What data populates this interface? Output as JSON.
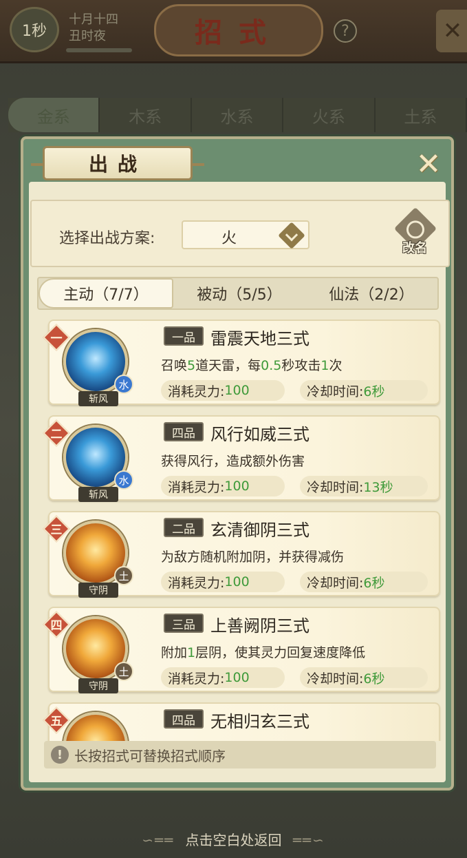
{
  "background": {
    "timer": "1秒",
    "date_line1": "十月十四",
    "date_line2": "丑时夜",
    "title": "招式",
    "help_icon": "question-icon",
    "close_icon": "close-icon",
    "element_tabs": [
      "金系",
      "木系",
      "水系",
      "火系",
      "土系"
    ],
    "active_element_tab": "金系"
  },
  "dialog": {
    "title": "出战",
    "close_icon": "close-icon",
    "scheme": {
      "label": "选择出战方案:",
      "value": "火",
      "rename_label": "改名"
    },
    "tabs": [
      {
        "label": "主动（7/7）",
        "active": true
      },
      {
        "label": "被动（5/5）",
        "active": false
      },
      {
        "label": "仙法（2/2）",
        "active": false
      }
    ],
    "skills": [
      {
        "rank": "一",
        "grade": "一品",
        "name": "雷震天地三式",
        "desc_parts": [
          "召唤",
          "5",
          "道天雷，每",
          "0.5",
          "秒攻击",
          "1",
          "次"
        ],
        "element": "水",
        "element_type": "water",
        "stance": "斩风",
        "cost_label": "消耗灵力:",
        "cost": "100",
        "cd_label": "冷却时间:",
        "cd": "6秒"
      },
      {
        "rank": "二",
        "grade": "四品",
        "name": "风行如威三式",
        "desc_parts": [
          "获得风行，造成额外伤害"
        ],
        "element": "水",
        "element_type": "water",
        "stance": "斩风",
        "cost_label": "消耗灵力:",
        "cost": "100",
        "cd_label": "冷却时间:",
        "cd": "13秒"
      },
      {
        "rank": "三",
        "grade": "二品",
        "name": "玄清御阴三式",
        "desc_parts": [
          "为敌方随机附加阴，并获得减伤"
        ],
        "element": "土",
        "element_type": "earth",
        "stance": "守阴",
        "cost_label": "消耗灵力:",
        "cost": "100",
        "cd_label": "冷却时间:",
        "cd": "6秒"
      },
      {
        "rank": "四",
        "grade": "三品",
        "name": "上善阙阴三式",
        "desc_parts": [
          "附加",
          "1",
          "层阴，使其灵力回复速度降低"
        ],
        "element": "土",
        "element_type": "earth",
        "stance": "守阴",
        "cost_label": "消耗灵力:",
        "cost": "100",
        "cd_label": "冷却时间:",
        "cd": "6秒"
      },
      {
        "rank": "五",
        "grade": "四品",
        "name": "无相归玄三式",
        "desc_parts": [
          ""
        ],
        "element": "",
        "element_type": "earth",
        "stance": "",
        "cost_label": "",
        "cost": "",
        "cd_label": "",
        "cd": ""
      }
    ],
    "hint": "长按招式可替换招式顺序",
    "hint_icon": "info-icon"
  },
  "return_hint": "点击空白处返回",
  "colors": {
    "highlight_green": "#3f9a3a",
    "rank_red": "#c7523a",
    "dialog_green": "#6c8e70",
    "parchment": "#efe9cf"
  }
}
